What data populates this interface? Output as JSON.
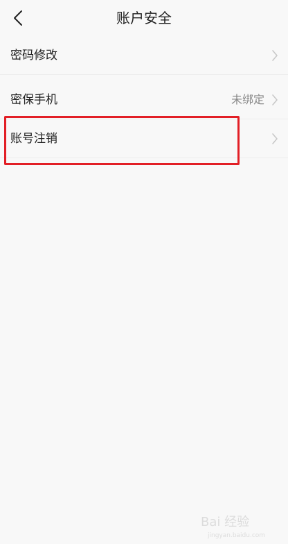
{
  "header": {
    "title": "账户安全"
  },
  "rows": [
    {
      "label": "密码修改",
      "value": ""
    },
    {
      "label": "密保手机",
      "value": "未绑定"
    },
    {
      "label": "账号注销",
      "value": ""
    }
  ],
  "watermark": {
    "text": "Bai 经验",
    "subtext": "jingyan.baidu.com"
  },
  "colors": {
    "highlight": "#e21f26",
    "background": "#f8f8f8",
    "text": "#222222",
    "muted": "#888888"
  }
}
